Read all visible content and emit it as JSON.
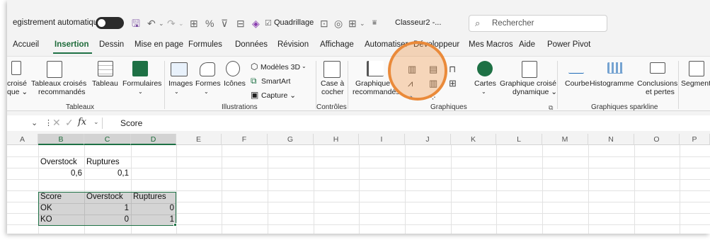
{
  "titlebar": {
    "autosave_label": "egistrement automatique",
    "gridlines_label": "Quadrillage",
    "filename": "Classeur2 -...",
    "search_placeholder": "Rechercher"
  },
  "tabs": [
    {
      "label": "Accueil"
    },
    {
      "label": "Insertion"
    },
    {
      "label": "Dessin"
    },
    {
      "label": "Mise en page"
    },
    {
      "label": "Formules"
    },
    {
      "label": "Données"
    },
    {
      "label": "Révision"
    },
    {
      "label": "Affichage"
    },
    {
      "label": "Automatiser"
    },
    {
      "label": "Développeur"
    },
    {
      "label": "Mes Macros"
    },
    {
      "label": "Aide"
    },
    {
      "label": "Power Pivot"
    }
  ],
  "ribbon": {
    "tableaux": {
      "group_label": "Tableaux",
      "pivot_label_1": "croisé",
      "pivot_label_2": "que ⌄",
      "recommended_label_1": "Tableaux croisés",
      "recommended_label_2": "recommandés",
      "table_label": "Tableau",
      "forms_label": "Formulaires"
    },
    "illustrations": {
      "group_label": "Illustrations",
      "images_label": "Images",
      "shapes_label": "Formes",
      "icons_label": "Icônes",
      "models3d_label": "Modèles 3D",
      "smartart_label": "SmartArt",
      "capture_label": "Capture ⌄"
    },
    "controles": {
      "group_label": "Contrôles",
      "checkbox_label_1": "Case à",
      "checkbox_label_2": "cocher"
    },
    "graphiques": {
      "group_label": "Graphiques",
      "recommended_label_1": "Graphique",
      "recommended_label_2": "recommandés",
      "maps_label": "Cartes",
      "pivotchart_label_1": "Graphique croisé",
      "pivotchart_label_2": "dynamique ⌄"
    },
    "sparklines": {
      "group_label": "Graphiques sparkline",
      "line_label": "Courbe",
      "histogram_label": "Histogramme",
      "winloss_label_1": "Conclusions",
      "winloss_label_2": "et pertes"
    },
    "slicer_label": "Segment"
  },
  "formula_bar": {
    "content": "Score"
  },
  "columns": [
    "A",
    "B",
    "C",
    "D",
    "E",
    "F",
    "G",
    "H",
    "I",
    "J",
    "K",
    "L",
    "M",
    "N",
    "O",
    "P"
  ],
  "cells": {
    "overstock_label": "Overstock",
    "ruptures_label": "Ruptures",
    "overstock_weight": "0,6",
    "ruptures_weight": "0,1",
    "table_header": [
      "Score",
      "Overstock",
      "Ruptures"
    ],
    "table_rows": [
      [
        "OK",
        "1",
        "0"
      ],
      [
        "KO",
        "0",
        "1"
      ]
    ]
  },
  "colors": {
    "accent_green": "#1e7145",
    "highlight_orange": "#ea8a3a"
  }
}
